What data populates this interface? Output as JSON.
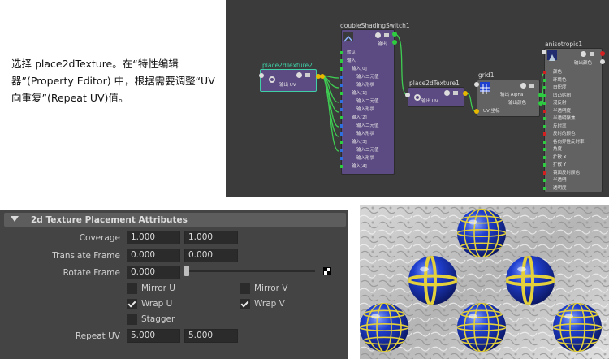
{
  "caption": "选择 place2dTexture。在“特性编辑器”(Property Editor) 中，根据需要调整“UV 向重复”(Repeat UV)值。",
  "node_editor": {
    "nodes": {
      "place2d": {
        "title": "place2dTexture2",
        "out_label": "输出 UV"
      },
      "switch": {
        "title": "doubleShadingSwitch1",
        "out_label": "输出",
        "rows": [
          "默认",
          "输入",
          "输入[0]",
          "输入二元值",
          "输入形状",
          "输入[1]",
          "输入二元值",
          "输入形状",
          "输入[2]",
          "输入二元值",
          "输入形状",
          "输入[3]",
          "输入二元值",
          "输入形状",
          "输入[4]"
        ]
      },
      "place2d1": {
        "title": "place2dTexture1",
        "out_label": "输出 UV"
      },
      "grid": {
        "title": "grid1",
        "out_alpha": "输出 Alpha",
        "out_color": "输出颜色",
        "in_uv": "UV 坐标"
      },
      "aniso": {
        "title": "anisotropic1",
        "out_color": "输出颜色",
        "rows": [
          "颜色",
          "环境色",
          "白炽度",
          "凹凸贴图",
          "漫反射",
          "半透明度",
          "半透明聚焦",
          "反射率",
          "反射的颜色",
          "各向异性反射率",
          "角度",
          "扩散 X",
          "扩散 Y",
          "镜面反射颜色",
          "半透明",
          "透明度"
        ]
      }
    },
    "colors": {
      "bg": "#3b3b3b",
      "purple": "#5c4a82",
      "grey_node": "#626262",
      "wire": "#3fcc52",
      "port_green": "#2ecc40",
      "port_yellow": "#e6b800",
      "port_red": "#d42020",
      "port_blue": "#2f6fe0",
      "select": "#3fd0a8"
    }
  },
  "attr_editor": {
    "section_title": "2d Texture Placement Attributes",
    "coverage": {
      "label": "Coverage",
      "u": "1.000",
      "v": "1.000"
    },
    "translate_frame": {
      "label": "Translate Frame",
      "u": "0.000",
      "v": "0.000"
    },
    "rotate_frame": {
      "label": "Rotate Frame",
      "value": "0.000",
      "slider_level": 0.0
    },
    "mirror_u": {
      "label": "Mirror U",
      "checked": false
    },
    "mirror_v": {
      "label": "Mirror V",
      "checked": false
    },
    "wrap_u": {
      "label": "Wrap U",
      "checked": true
    },
    "wrap_v": {
      "label": "Wrap V",
      "checked": true
    },
    "stagger": {
      "label": "Stagger",
      "checked": false
    },
    "repeat_uv": {
      "label": "Repeat UV",
      "u": "5.000",
      "v": "5.000"
    }
  },
  "render": {
    "spheres": 6,
    "sphere_colors": {
      "blue": "#1f3fcf",
      "grid": "#e4d03a"
    }
  }
}
